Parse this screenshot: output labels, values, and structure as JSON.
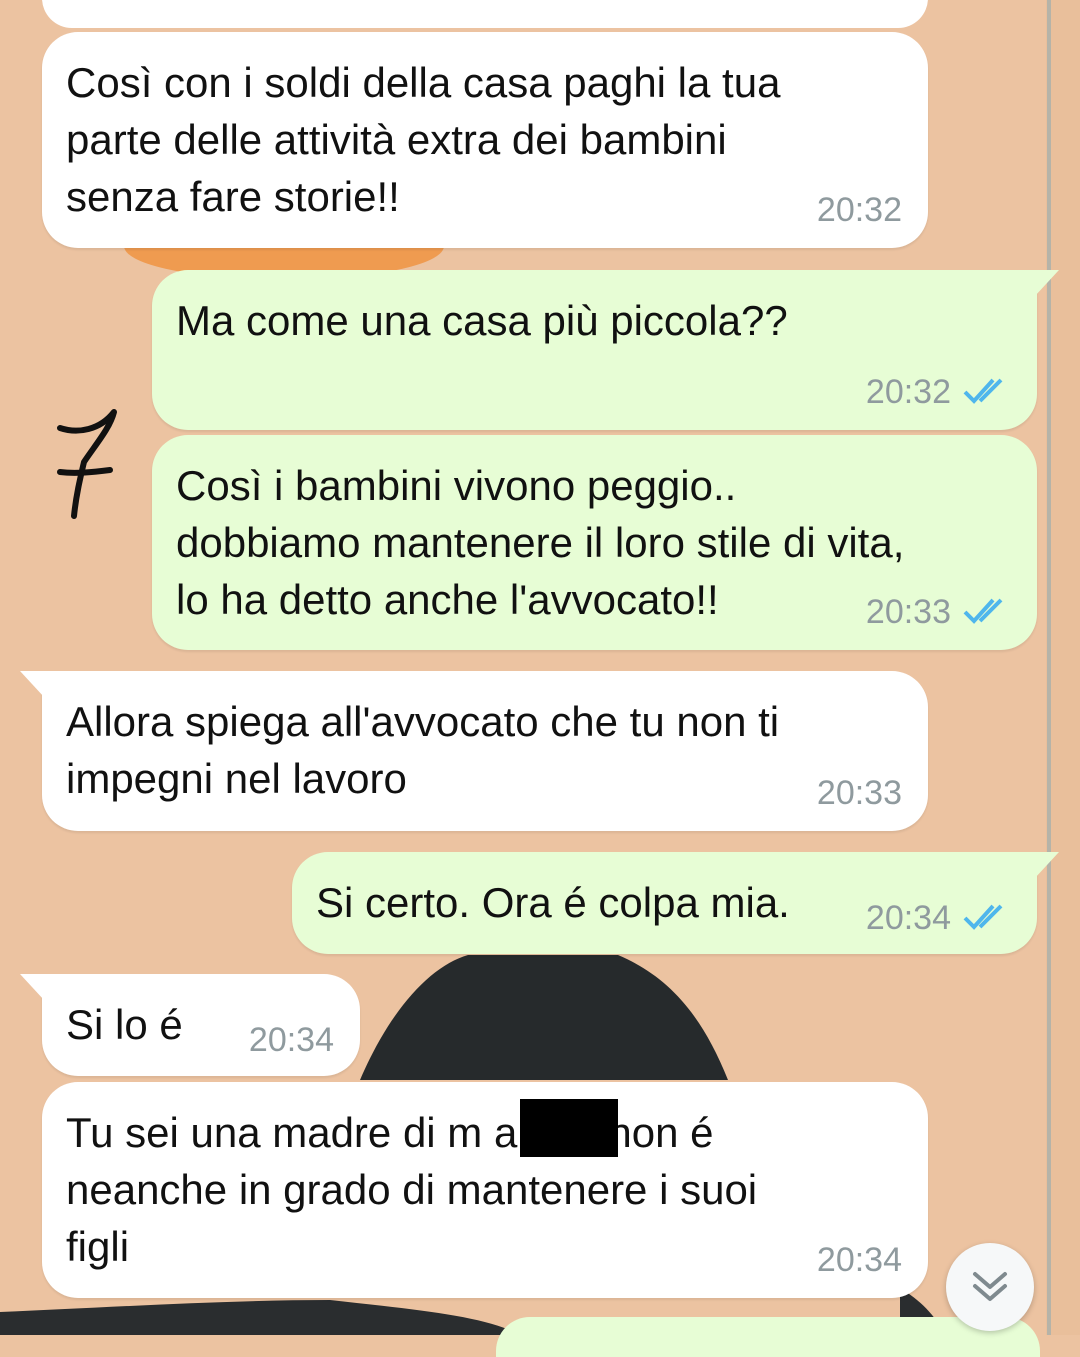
{
  "chat": {
    "messages": [
      {
        "direction": "in",
        "text": "Così con i soldi della casa paghi la tua\nparte delle attività extra dei bambini\nsenza fare storie!!",
        "time": "20:32"
      },
      {
        "direction": "out",
        "text": "Ma come una casa più piccola??",
        "time": "20:32",
        "status": "read"
      },
      {
        "direction": "out",
        "text": "Così i bambini vivono peggio..\ndobbiamo mantenere il loro stile di vita,\nlo ha detto anche l'avvocato!!",
        "time": "20:33",
        "status": "read"
      },
      {
        "direction": "in",
        "text": "Allora spiega all'avvocato che tu non ti\nimpegni nel lavoro",
        "time": "20:33"
      },
      {
        "direction": "out",
        "text": "Si certo. Ora é colpa mia.",
        "time": "20:34",
        "status": "read"
      },
      {
        "direction": "in",
        "text": "Si lo é",
        "time": "20:34"
      },
      {
        "direction": "in",
        "text": "Tu sei una madre di m         a che non é\nneanche in grado di mantenere i suoi\nfigli",
        "time": "20:34"
      }
    ]
  },
  "annotation": {
    "handwritten_mark": "7"
  },
  "colors": {
    "wallpaper": "#ecc3a1",
    "incoming_bubble": "#ffffff",
    "outgoing_bubble": "#e7fdd5",
    "read_ticks": "#4fb6ec",
    "timestamp": "#8f9a9e"
  },
  "icons": {
    "read_receipt": "double-check-icon",
    "scroll_down": "chevron-down-double-icon"
  }
}
